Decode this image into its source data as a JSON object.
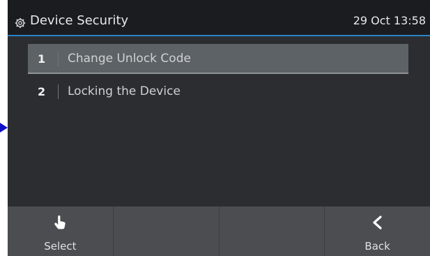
{
  "header": {
    "title": "Device Security",
    "datetime": "29 Oct 13:58",
    "title_icon": "gear-icon",
    "accent_color": "#2b84c6"
  },
  "menu": {
    "items": [
      {
        "number": "1",
        "label": "Change Unlock Code",
        "selected": true
      },
      {
        "number": "2",
        "label": "Locking the Device",
        "selected": false
      }
    ]
  },
  "softkeys": [
    {
      "label": "Select",
      "icon": "hand-pointer-icon"
    },
    {
      "label": "",
      "icon": ""
    },
    {
      "label": "",
      "icon": ""
    },
    {
      "label": "Back",
      "icon": "chevron-left-icon"
    }
  ],
  "pointer_marker": {
    "icon": "arrow-right-icon",
    "color": "#1010c8"
  }
}
